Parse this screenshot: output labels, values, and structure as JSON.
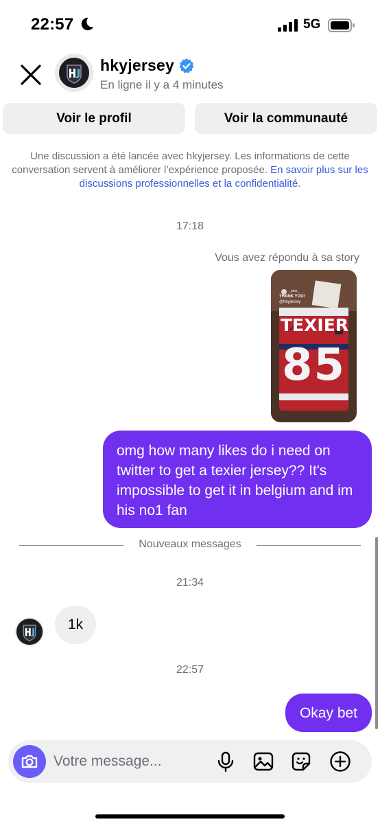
{
  "status_bar": {
    "time": "22:57",
    "network": "5G",
    "icons": [
      "moon-icon",
      "signal-icon",
      "battery-icon"
    ]
  },
  "header": {
    "username": "hkyjersey",
    "status": "En ligne il y a 4 minutes",
    "icons": [
      "close-icon",
      "verified-badge-icon"
    ],
    "verified_color": "#3897f0"
  },
  "buttons": {
    "profile": "Voir le profil",
    "community": "Voir la communauté"
  },
  "disclaimer": {
    "text": "Une discussion a été lancée avec hkyjersey. Les informations de cette conversation servent à améliorer l’expérience proposée. ",
    "link": "En savoir plus sur les discussions professionnelles et la confidentialité",
    "end": "."
  },
  "thread": {
    "time_1": "17:18",
    "story_reply_label": "Vous avez répondu à sa story",
    "story": {
      "handle": "_user_",
      "caption": "THANK YOU!",
      "mention": "@hkyjersey",
      "jersey_name": "TEXIER",
      "jersey_number": "85"
    },
    "outgoing_1": "omg how many likes do i need on twitter to get a texier jersey?? It's impossible to get it in belgium and im his no1 fan",
    "new_messages_label": "Nouveaux messages",
    "time_2": "21:34",
    "incoming_1": "1k",
    "time_3": "22:57",
    "outgoing_2": "Okay bet"
  },
  "composer": {
    "placeholder": "Votre message...",
    "icons": [
      "camera-icon",
      "microphone-icon",
      "image-icon",
      "sticker-icon",
      "plus-icon"
    ]
  },
  "colors": {
    "outgoing_bubble": "#7130f0",
    "incoming_bubble": "#efeff1",
    "camera_button": "#6a5cf6",
    "link": "#3b5bdb"
  }
}
